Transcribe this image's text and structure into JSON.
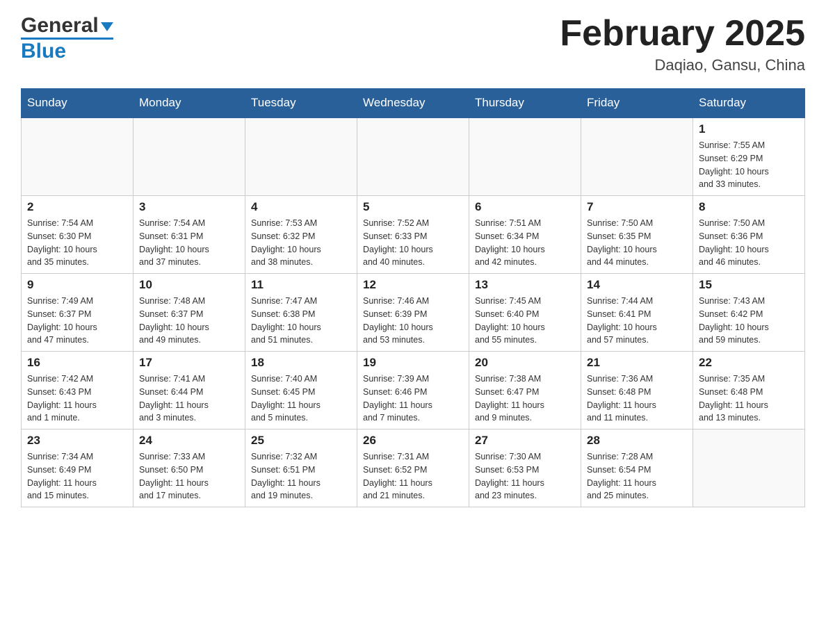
{
  "header": {
    "logo": {
      "text_general": "General",
      "text_blue": "Blue"
    },
    "title": "February 2025",
    "location": "Daqiao, Gansu, China"
  },
  "days_of_week": [
    "Sunday",
    "Monday",
    "Tuesday",
    "Wednesday",
    "Thursday",
    "Friday",
    "Saturday"
  ],
  "weeks": [
    [
      {
        "day": "",
        "info": ""
      },
      {
        "day": "",
        "info": ""
      },
      {
        "day": "",
        "info": ""
      },
      {
        "day": "",
        "info": ""
      },
      {
        "day": "",
        "info": ""
      },
      {
        "day": "",
        "info": ""
      },
      {
        "day": "1",
        "info": "Sunrise: 7:55 AM\nSunset: 6:29 PM\nDaylight: 10 hours\nand 33 minutes."
      }
    ],
    [
      {
        "day": "2",
        "info": "Sunrise: 7:54 AM\nSunset: 6:30 PM\nDaylight: 10 hours\nand 35 minutes."
      },
      {
        "day": "3",
        "info": "Sunrise: 7:54 AM\nSunset: 6:31 PM\nDaylight: 10 hours\nand 37 minutes."
      },
      {
        "day": "4",
        "info": "Sunrise: 7:53 AM\nSunset: 6:32 PM\nDaylight: 10 hours\nand 38 minutes."
      },
      {
        "day": "5",
        "info": "Sunrise: 7:52 AM\nSunset: 6:33 PM\nDaylight: 10 hours\nand 40 minutes."
      },
      {
        "day": "6",
        "info": "Sunrise: 7:51 AM\nSunset: 6:34 PM\nDaylight: 10 hours\nand 42 minutes."
      },
      {
        "day": "7",
        "info": "Sunrise: 7:50 AM\nSunset: 6:35 PM\nDaylight: 10 hours\nand 44 minutes."
      },
      {
        "day": "8",
        "info": "Sunrise: 7:50 AM\nSunset: 6:36 PM\nDaylight: 10 hours\nand 46 minutes."
      }
    ],
    [
      {
        "day": "9",
        "info": "Sunrise: 7:49 AM\nSunset: 6:37 PM\nDaylight: 10 hours\nand 47 minutes."
      },
      {
        "day": "10",
        "info": "Sunrise: 7:48 AM\nSunset: 6:37 PM\nDaylight: 10 hours\nand 49 minutes."
      },
      {
        "day": "11",
        "info": "Sunrise: 7:47 AM\nSunset: 6:38 PM\nDaylight: 10 hours\nand 51 minutes."
      },
      {
        "day": "12",
        "info": "Sunrise: 7:46 AM\nSunset: 6:39 PM\nDaylight: 10 hours\nand 53 minutes."
      },
      {
        "day": "13",
        "info": "Sunrise: 7:45 AM\nSunset: 6:40 PM\nDaylight: 10 hours\nand 55 minutes."
      },
      {
        "day": "14",
        "info": "Sunrise: 7:44 AM\nSunset: 6:41 PM\nDaylight: 10 hours\nand 57 minutes."
      },
      {
        "day": "15",
        "info": "Sunrise: 7:43 AM\nSunset: 6:42 PM\nDaylight: 10 hours\nand 59 minutes."
      }
    ],
    [
      {
        "day": "16",
        "info": "Sunrise: 7:42 AM\nSunset: 6:43 PM\nDaylight: 11 hours\nand 1 minute."
      },
      {
        "day": "17",
        "info": "Sunrise: 7:41 AM\nSunset: 6:44 PM\nDaylight: 11 hours\nand 3 minutes."
      },
      {
        "day": "18",
        "info": "Sunrise: 7:40 AM\nSunset: 6:45 PM\nDaylight: 11 hours\nand 5 minutes."
      },
      {
        "day": "19",
        "info": "Sunrise: 7:39 AM\nSunset: 6:46 PM\nDaylight: 11 hours\nand 7 minutes."
      },
      {
        "day": "20",
        "info": "Sunrise: 7:38 AM\nSunset: 6:47 PM\nDaylight: 11 hours\nand 9 minutes."
      },
      {
        "day": "21",
        "info": "Sunrise: 7:36 AM\nSunset: 6:48 PM\nDaylight: 11 hours\nand 11 minutes."
      },
      {
        "day": "22",
        "info": "Sunrise: 7:35 AM\nSunset: 6:48 PM\nDaylight: 11 hours\nand 13 minutes."
      }
    ],
    [
      {
        "day": "23",
        "info": "Sunrise: 7:34 AM\nSunset: 6:49 PM\nDaylight: 11 hours\nand 15 minutes."
      },
      {
        "day": "24",
        "info": "Sunrise: 7:33 AM\nSunset: 6:50 PM\nDaylight: 11 hours\nand 17 minutes."
      },
      {
        "day": "25",
        "info": "Sunrise: 7:32 AM\nSunset: 6:51 PM\nDaylight: 11 hours\nand 19 minutes."
      },
      {
        "day": "26",
        "info": "Sunrise: 7:31 AM\nSunset: 6:52 PM\nDaylight: 11 hours\nand 21 minutes."
      },
      {
        "day": "27",
        "info": "Sunrise: 7:30 AM\nSunset: 6:53 PM\nDaylight: 11 hours\nand 23 minutes."
      },
      {
        "day": "28",
        "info": "Sunrise: 7:28 AM\nSunset: 6:54 PM\nDaylight: 11 hours\nand 25 minutes."
      },
      {
        "day": "",
        "info": ""
      }
    ]
  ]
}
